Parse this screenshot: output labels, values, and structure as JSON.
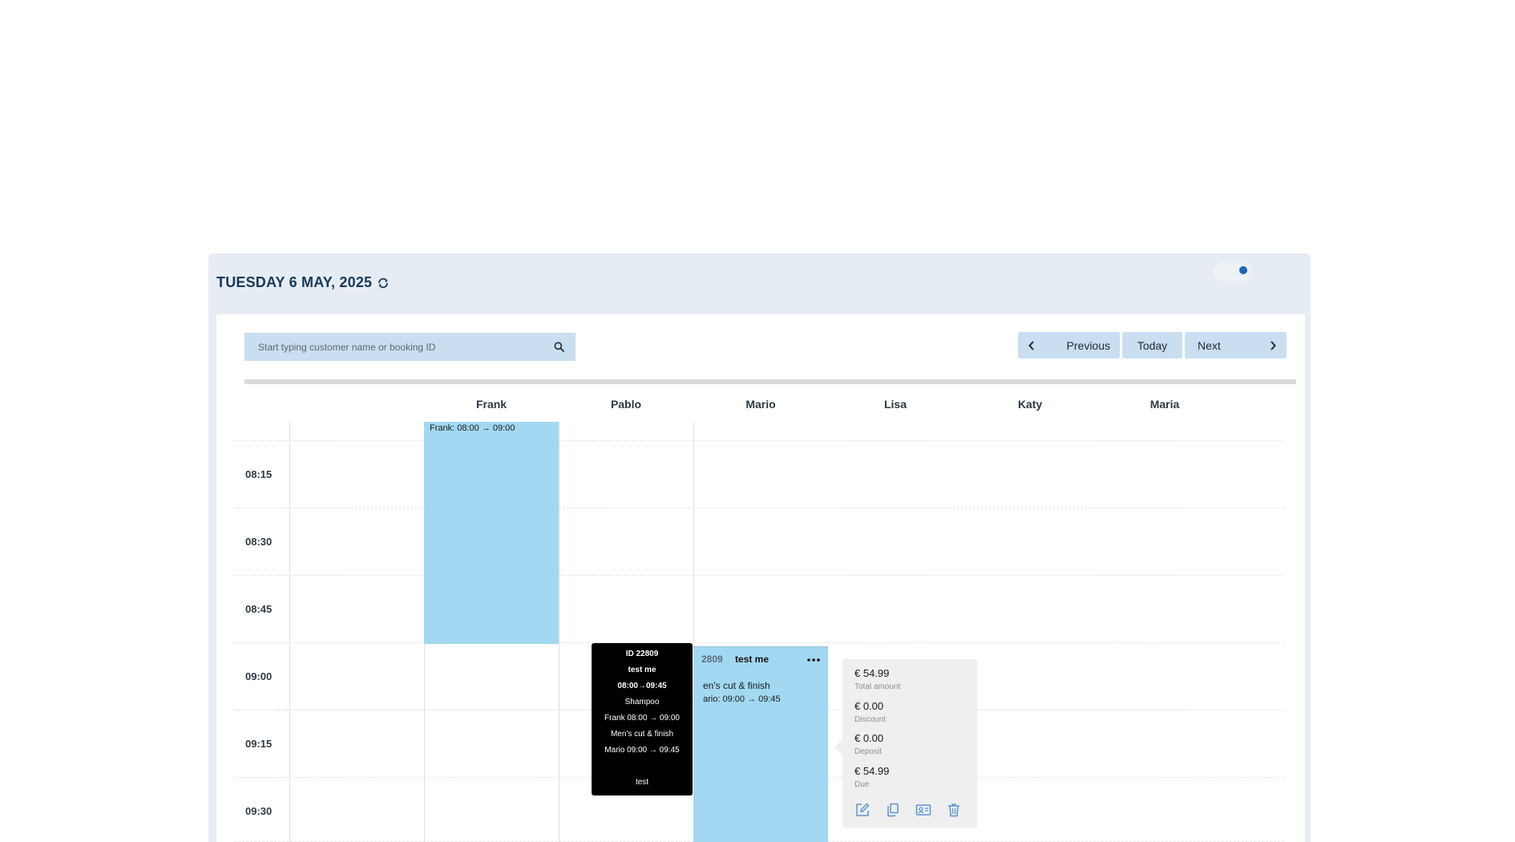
{
  "header": {
    "date_title": "TUESDAY 6 MAY, 2025",
    "refresh_icon": "refresh-icon",
    "toggle_state": "on"
  },
  "search": {
    "placeholder": "Start typing customer name or booking ID",
    "icon": "search-icon"
  },
  "nav": {
    "previous_label": "Previous",
    "today_label": "Today",
    "next_label": "Next"
  },
  "staff": [
    "Frank",
    "Pablo",
    "Mario",
    "Lisa",
    "Katy",
    "Maria"
  ],
  "times": [
    "08:15",
    "08:30",
    "08:45",
    "09:00",
    "09:15",
    "09:30"
  ],
  "appointments": {
    "frank": {
      "label": "Frank: 08:00 → 09:00"
    },
    "mario": {
      "id_fragment": "2809",
      "customer": "test me",
      "service": "en's cut & finish",
      "time": "ario: 09:00 → 09:45"
    }
  },
  "tooltip": {
    "id": "ID 22809",
    "customer": "test me",
    "time": "08:00→09:45",
    "service1": "Shampoo",
    "service1_staff": "Frank 08:00 → 09:00",
    "service2": "Men's cut & finish",
    "service2_staff": "Mario 09:00 → 09:45",
    "note": "test"
  },
  "payment": {
    "total_amount": "€ 54.99",
    "total_label": "Total amount",
    "discount_amount": "€ 0.00",
    "discount_label": "Discount",
    "deposit_amount": "€ 0.00",
    "deposit_label": "Deposit",
    "due_amount": "€ 54.99",
    "due_label": "Due",
    "icons": [
      "edit-icon",
      "copy-icon",
      "contact-card-icon",
      "trash-icon"
    ]
  },
  "colors": {
    "appointment": "#a2d8f2",
    "button": "#c9def0",
    "title": "#163a5a",
    "toggle_knob": "#1b66b7"
  }
}
